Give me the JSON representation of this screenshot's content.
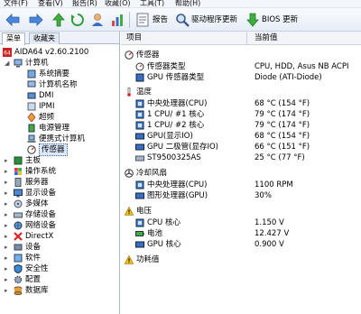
{
  "menu": [
    "文件(F)",
    "查看(V)",
    "报告(R)",
    "收藏(O)",
    "工具(T)",
    "帮助(H)"
  ],
  "toolbar": {
    "report": "报告",
    "driver_update": "驱动程序更新",
    "bios_update": "BIOS 更新"
  },
  "left": {
    "tabs": [
      "菜单",
      "收藏夹"
    ],
    "tree": [
      {
        "label": "AIDA64 v2.60.2100",
        "icon": "aida64-logo-icon"
      },
      {
        "label": "计算机",
        "icon": "computer-icon"
      },
      {
        "label": "系统摘要",
        "icon": "summary-icon"
      },
      {
        "label": "计算机名称",
        "icon": "computer-name-icon"
      },
      {
        "label": "DMI",
        "icon": "dmi-icon"
      },
      {
        "label": "IPMI",
        "icon": "ipmi-icon"
      },
      {
        "label": "超频",
        "icon": "overclock-icon"
      },
      {
        "label": "电源管理",
        "icon": "power-management-icon"
      },
      {
        "label": "便携式计算机",
        "icon": "portable-computer-icon"
      },
      {
        "label": "传感器",
        "icon": "sensor-icon"
      },
      {
        "label": "主板",
        "icon": "motherboard-icon"
      },
      {
        "label": "操作系统",
        "icon": "operating-system-icon"
      },
      {
        "label": "服务器",
        "icon": "server-icon"
      },
      {
        "label": "显示设备",
        "icon": "display-icon"
      },
      {
        "label": "多媒体",
        "icon": "multimedia-icon"
      },
      {
        "label": "存储设备",
        "icon": "storage-icon"
      },
      {
        "label": "网络设备",
        "icon": "network-icon"
      },
      {
        "label": "DirectX",
        "icon": "directx-icon"
      },
      {
        "label": "设备",
        "icon": "devices-icon"
      },
      {
        "label": "软件",
        "icon": "software-icon"
      },
      {
        "label": "安全性",
        "icon": "security-icon"
      },
      {
        "label": "配置",
        "icon": "config-icon"
      },
      {
        "label": "数据库",
        "icon": "database-icon"
      }
    ]
  },
  "right": {
    "headers": [
      "项目",
      "当前值"
    ],
    "rows": [
      {
        "kind": "section",
        "key": "传感器",
        "icon": "sensor-icon"
      },
      {
        "kind": "item",
        "key": "传感器类型",
        "value": "CPU, HDD, Asus NB ACPI",
        "icon": "sensor-type-icon"
      },
      {
        "kind": "item",
        "key": "GPU 传感器类型",
        "value": "Diode  (ATI-Diode)",
        "icon": "gpu-sensor-icon"
      },
      {
        "kind": "section",
        "key": "温度",
        "icon": "temperature-icon"
      },
      {
        "kind": "item",
        "key": "中央处理器(CPU)",
        "value": "68 °C  (154 °F)",
        "icon": "cpu-icon"
      },
      {
        "kind": "item",
        "key": "1 CPU/ #1 核心",
        "value": "79 °C  (174 °F)",
        "icon": "cpu-core-icon"
      },
      {
        "kind": "item",
        "key": "1 CPU/ #2 核心",
        "value": "79 °C  (174 °F)",
        "icon": "cpu-core-icon"
      },
      {
        "kind": "item",
        "key": "GPU(显示IO)",
        "value": "68 °C  (154 °F)",
        "icon": "gpu-icon"
      },
      {
        "kind": "item",
        "key": "GPU 二极管(显存IO)",
        "value": "66 °C  (151 °F)",
        "icon": "gpu-diode-icon"
      },
      {
        "kind": "item",
        "key": "ST9500325AS",
        "value": "25 °C  (77 °F)",
        "icon": "hdd-icon"
      },
      {
        "kind": "section",
        "key": "冷却风扇",
        "icon": "fan-icon"
      },
      {
        "kind": "item",
        "key": "中央处理器(CPU)",
        "value": "1100 RPM",
        "icon": "cpu-icon"
      },
      {
        "kind": "item",
        "key": "图形处理器(GPU)",
        "value": "30%",
        "icon": "gpu-icon"
      },
      {
        "kind": "section",
        "key": "电压",
        "icon": "warning-icon"
      },
      {
        "kind": "item",
        "key": "CPU 核心",
        "value": "1.150 V",
        "icon": "cpu-icon"
      },
      {
        "kind": "item",
        "key": "电池",
        "value": "12.427 V",
        "icon": "battery-icon"
      },
      {
        "kind": "item",
        "key": "GPU 核心",
        "value": "0.900 V",
        "icon": "gpu-icon"
      },
      {
        "kind": "section",
        "key": "功耗值",
        "icon": "warning-icon"
      }
    ]
  }
}
